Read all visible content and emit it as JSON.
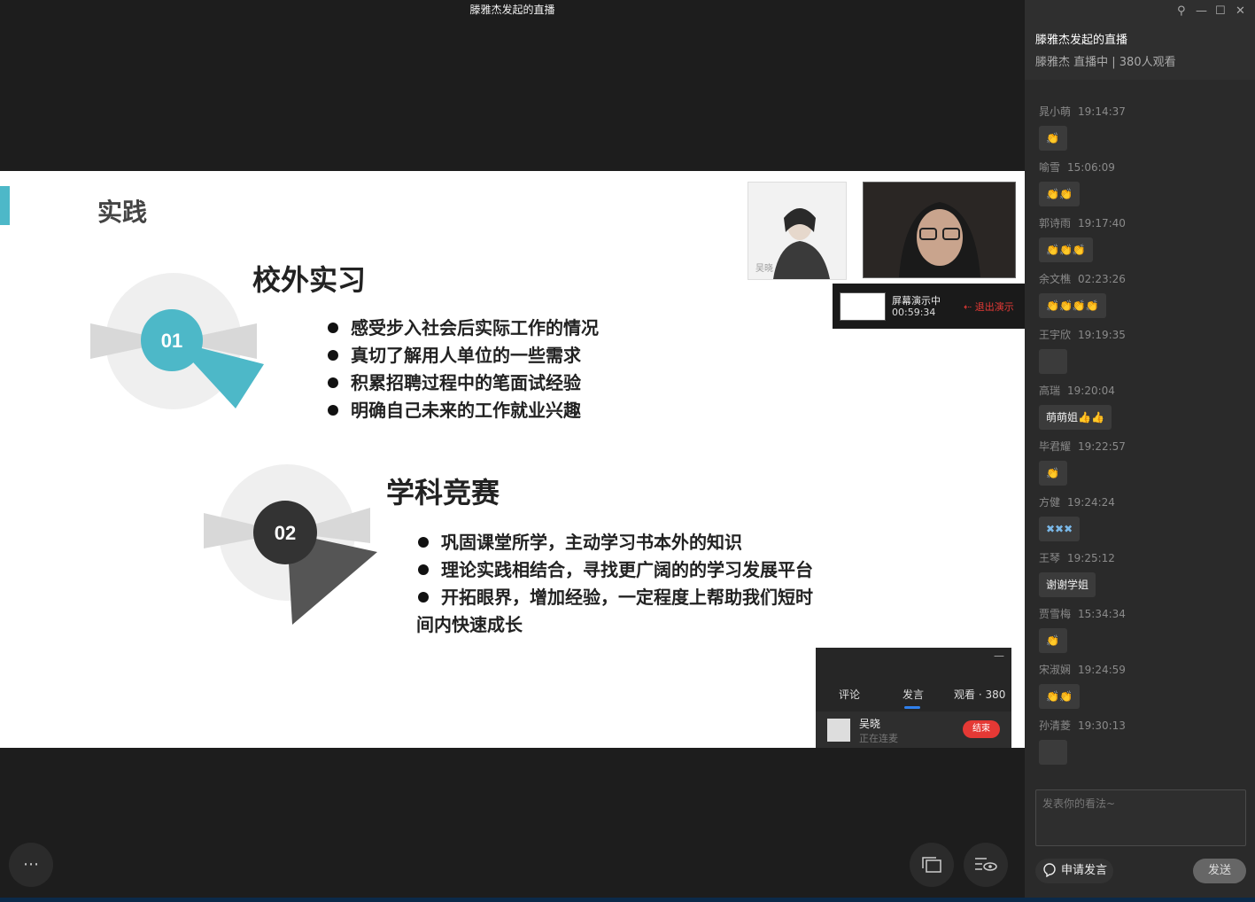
{
  "window": {
    "title": "滕雅杰发起的直播"
  },
  "slide": {
    "heading": "实践",
    "section1": {
      "number": "01",
      "title": "校外实习",
      "bullets": [
        "感受步入社会后实际工作的情况",
        "真切了解用人单位的一些需求",
        "积累招聘过程中的笔面试经验",
        "明确自己未来的工作就业兴趣"
      ]
    },
    "section2": {
      "number": "02",
      "title": "学科竞赛",
      "bullets": [
        "巩固课堂所学，主动学习书本外的知识",
        "理论实践相结合，寻找更广阔的的学习发展平台",
        "开拓眼界，增加经验，一定程度上帮助我们短时",
        "间内快速成长"
      ]
    },
    "accent_color": "#4db8c8"
  },
  "cameras": {
    "left_label": "吴晓"
  },
  "presenting": {
    "status": "屏幕演示中",
    "elapsed": "00:59:34",
    "exit_label": "退出演示"
  },
  "mini_panel": {
    "tabs": [
      "评论",
      "发言",
      "观看 · 380"
    ],
    "speaker": {
      "name": "吴晓",
      "status": "正在连麦",
      "end_label": "结束"
    }
  },
  "bottom_controls": {
    "more": "⋯"
  },
  "sidebar": {
    "title": "滕雅杰发起的直播",
    "subtitle": "滕雅杰 直播中 | 380人观看",
    "messages": [
      {
        "user": "晁小萌",
        "time": "19:14:37",
        "content": "👏"
      },
      {
        "user": "喻雪",
        "time": "15:06:09",
        "content": "👏👏"
      },
      {
        "user": "郭诗雨",
        "time": "19:17:40",
        "content": "👏👏👏"
      },
      {
        "user": "余文樵",
        "time": "02:23:26",
        "content": "👏👏👏👏"
      },
      {
        "user": "王宇欣",
        "time": "19:19:35",
        "content": ""
      },
      {
        "user": "高瑞",
        "time": "19:20:04",
        "content": "萌萌姐👍👍"
      },
      {
        "user": "毕君耀",
        "time": "19:22:57",
        "content": "👏"
      },
      {
        "user": "方健",
        "time": "19:24:24",
        "content": "✖✖✖"
      },
      {
        "user": "王琴",
        "time": "19:25:12",
        "content": "谢谢学姐"
      },
      {
        "user": "贾雪梅",
        "time": "15:34:34",
        "content": "👏"
      },
      {
        "user": "宋淑娴",
        "time": "19:24:59",
        "content": "👏👏"
      },
      {
        "user": "孙清菱",
        "time": "19:30:13",
        "content": ""
      }
    ],
    "input_placeholder": "发表你的看法~",
    "apply_label": "申请发言",
    "send_label": "发送"
  }
}
